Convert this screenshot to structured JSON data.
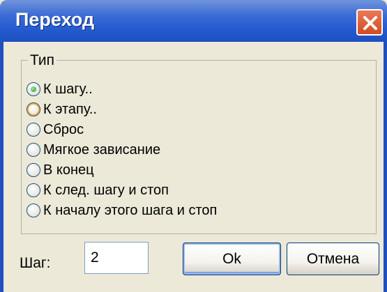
{
  "window": {
    "title": "Переход"
  },
  "group": {
    "legend": "Тип",
    "options": [
      {
        "label": "К шагу..",
        "state": "checked"
      },
      {
        "label": "К этапу..",
        "state": "hover"
      },
      {
        "label": "Сброс",
        "state": "normal"
      },
      {
        "label": "Мягкое зависание",
        "state": "normal"
      },
      {
        "label": "В конец",
        "state": "normal"
      },
      {
        "label": "К след. шагу и стоп",
        "state": "normal"
      },
      {
        "label": "К началу этого шага и стоп",
        "state": "normal"
      }
    ]
  },
  "step": {
    "label": "Шаг:",
    "value": "2"
  },
  "buttons": {
    "ok": "Ok",
    "cancel": "Отмена"
  },
  "colors": {
    "titlebar": "#245bd0",
    "close": "#d24b22",
    "dialog_bg": "#ece9d8",
    "radio_checked": "#21a121",
    "radio_hover": "#f8b33c"
  }
}
